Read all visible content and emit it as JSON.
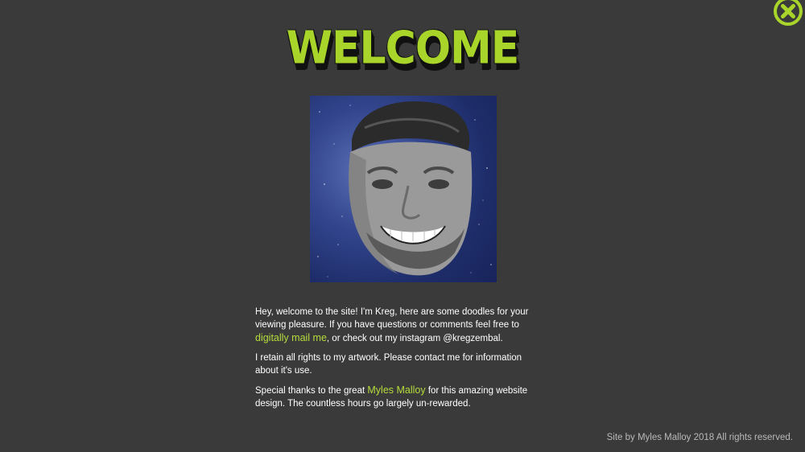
{
  "header": {
    "title": "WELCOME"
  },
  "close_button": {
    "icon": "close-icon",
    "color": "#a9d52a"
  },
  "portrait": {
    "alt": "Kreg portrait"
  },
  "bio": {
    "p1_text_before": "Hey, welcome to the site! I'm Kreg, here are some doodles for your viewing pleasure. If you have questions or comments feel free to ",
    "p1_link": "digitally mail me",
    "p1_text_after": ", or check out my instagram @kregzembal.",
    "p2_text": "I retain all rights to my artwork. Please contact me for information about it's use.",
    "p3_text_before": "Special thanks to the great ",
    "p3_link": "Myles Malloy",
    "p3_text_after": " for this amazing website design. The countless hours go largely un-rewarded."
  },
  "footer": {
    "text": "Site by Myles Malloy 2018 All rights reserved."
  },
  "colors": {
    "background": "#3a3a3a",
    "accent": "#a9d52a",
    "text": "#ffffff",
    "footer_text": "#b9b9b9"
  }
}
